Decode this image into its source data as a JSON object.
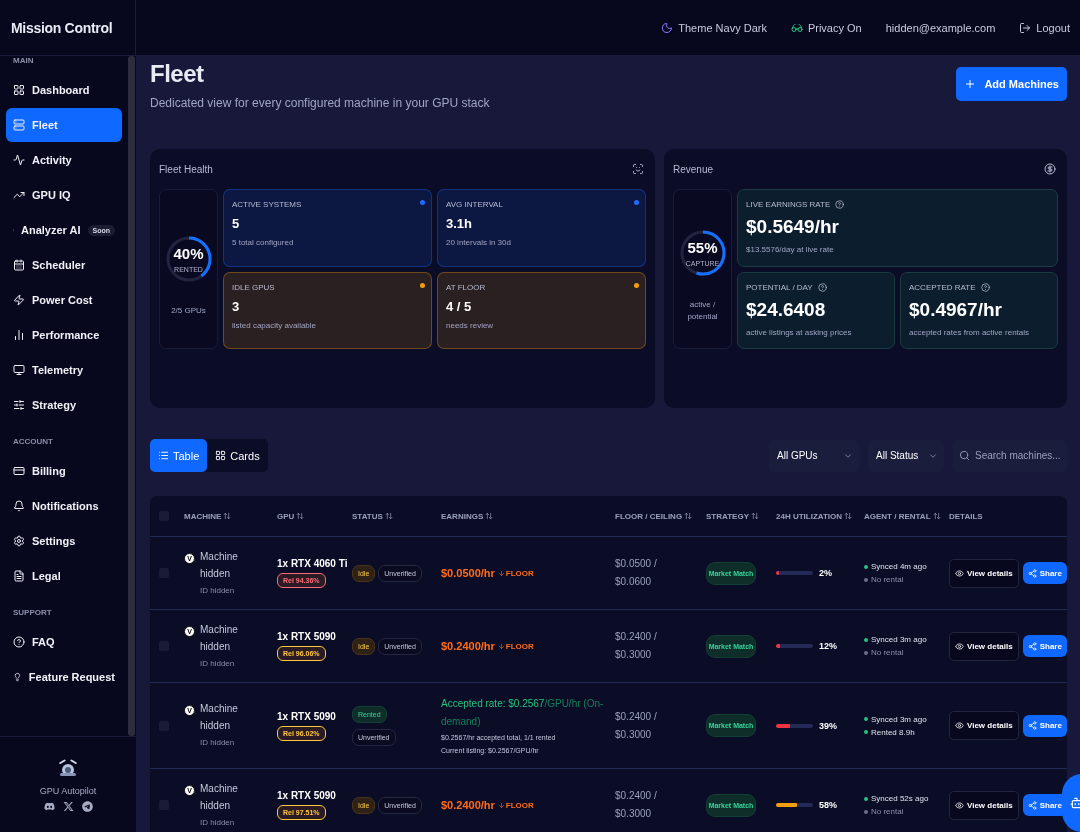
{
  "brand": "Mission Control",
  "topbar": {
    "theme": "Theme Navy Dark",
    "privacy": "Privacy On",
    "email": "hidden@example.com",
    "logout": "Logout"
  },
  "sidebar": {
    "sections": [
      {
        "title": "MAIN",
        "items": [
          {
            "label": "Dashboard",
            "selected": false
          },
          {
            "label": "Fleet",
            "selected": true
          },
          {
            "label": "Activity",
            "selected": false
          },
          {
            "label": "GPU IQ",
            "selected": false
          },
          {
            "label": "Analyzer AI",
            "selected": false,
            "badge": "Soon"
          },
          {
            "label": "Scheduler",
            "selected": false
          },
          {
            "label": "Power Cost",
            "selected": false
          },
          {
            "label": "Performance",
            "selected": false
          },
          {
            "label": "Telemetry",
            "selected": false
          },
          {
            "label": "Strategy",
            "selected": false
          }
        ]
      },
      {
        "title": "ACCOUNT",
        "items": [
          {
            "label": "Billing",
            "selected": false
          },
          {
            "label": "Notifications",
            "selected": false
          },
          {
            "label": "Settings",
            "selected": false
          },
          {
            "label": "Legal",
            "selected": false
          }
        ]
      },
      {
        "title": "SUPPORT",
        "items": [
          {
            "label": "FAQ",
            "selected": false
          },
          {
            "label": "Feature Request",
            "selected": false
          }
        ]
      }
    ],
    "footer": "GPU Autopilot"
  },
  "page": {
    "title": "Fleet",
    "subtitle": "Dedicated view for every configured machine in your GPU stack",
    "add_button": "Add Machines"
  },
  "fleet_health": {
    "title": "Fleet Health",
    "gauge": {
      "value": "40%",
      "label": "RENTED",
      "level": 0.4,
      "caption": "2/5 GPUs"
    },
    "stats": [
      {
        "label": "ACTIVE SYSTEMS",
        "value": "5",
        "note": "5 total configured",
        "color": "#1e6bff"
      },
      {
        "label": "AVG INTERVAL",
        "value": "3.1h",
        "note": "20 intervals in 30d",
        "color": "#1e6bff"
      },
      {
        "label": "IDLE GPUS",
        "value": "3",
        "note": "listed capacity available",
        "color": "#f59e0b"
      },
      {
        "label": "AT FLOOR",
        "value": "4 / 5",
        "note": "needs review",
        "color": "#f59e0b"
      }
    ]
  },
  "revenue": {
    "title": "Revenue",
    "gauge": {
      "value": "55%",
      "label": "CAPTURE",
      "level": 0.55,
      "caption": "active / potential"
    },
    "stats": [
      {
        "label": "LIVE EARNINGS RATE",
        "value": "$0.5649/hr",
        "note": "$13.5576/day at live rate"
      },
      {
        "label": "POTENTIAL / DAY",
        "value": "$24.6408",
        "note": "active listings at asking prices"
      },
      {
        "label": "ACCEPTED RATE",
        "value": "$0.4967/hr",
        "note": "accepted rates from active rentals"
      }
    ]
  },
  "view_toggle": [
    {
      "label": "Table",
      "selected": true
    },
    {
      "label": "Cards",
      "selected": false
    }
  ],
  "filters": [
    "All GPUs",
    "All Status"
  ],
  "search": {
    "placeholder": "Search machines..."
  },
  "table": {
    "select_all": {
      "checked": false
    },
    "columns": [
      {
        "label": "MACHINE",
        "sortable": true
      },
      {
        "label": "GPU",
        "sortable": true
      },
      {
        "label": "STATUS",
        "sortable": true
      },
      {
        "label": "EARNINGS",
        "sortable": true
      },
      {
        "label": "FLOOR / CEILING",
        "sortable": true
      },
      {
        "label": "STRATEGY",
        "sortable": true
      },
      {
        "label": "24H UTILIZATION",
        "sortable": true
      },
      {
        "label": "AGENT / RENTAL",
        "sortable": true
      },
      {
        "label": "DETAILS",
        "sortable": false
      }
    ],
    "rows": [
      {
        "checked": false,
        "logo": "V",
        "name": "Machine hidden",
        "id": "ID hidden",
        "gpu": "1x RTX 4060 Ti",
        "reliability": {
          "text": "Rel 94.36%",
          "color": "#ff6b78"
        },
        "statuses": [
          {
            "label": "Idle",
            "kind": "idle"
          },
          {
            "label": "Unverified",
            "kind": "unverified"
          }
        ],
        "earnings": {
          "kind": "floor",
          "rate": "$0.0500/hr",
          "tag": "FLOOR"
        },
        "floor": "$0.0500 /",
        "ceiling": "$0.0600",
        "strategy": "Market Match",
        "utilization": {
          "level": 0.02,
          "reading": "2%",
          "color": "#ef3340"
        },
        "agent": [
          {
            "text": "Synced 4m ago",
            "color": "#22c57e"
          },
          {
            "text": "No rental",
            "color": "#6b7288"
          }
        ],
        "view": "View details",
        "share": "Share"
      },
      {
        "checked": false,
        "logo": "V",
        "name": "Machine hidden",
        "id": "ID hidden",
        "gpu": "1x RTX 5090",
        "reliability": {
          "text": "Rel 96.06%",
          "color": "#ffc83d"
        },
        "statuses": [
          {
            "label": "Idle",
            "kind": "idle"
          },
          {
            "label": "Unverified",
            "kind": "unverified"
          }
        ],
        "earnings": {
          "kind": "floor",
          "rate": "$0.2400/hr",
          "tag": "FLOOR"
        },
        "floor": "$0.2400 /",
        "ceiling": "$0.3000",
        "strategy": "Market Match",
        "utilization": {
          "level": 0.12,
          "reading": "12%",
          "color": "#ef3340"
        },
        "agent": [
          {
            "text": "Synced 3m ago",
            "color": "#22c57e"
          },
          {
            "text": "No rental",
            "color": "#6b7288"
          }
        ],
        "view": "View details",
        "share": "Share"
      },
      {
        "checked": false,
        "logo": "V",
        "name": "Machine hidden",
        "id": "ID hidden",
        "gpu": "1x RTX 5090",
        "reliability": {
          "text": "Rel 96.02%",
          "color": "#ffc83d"
        },
        "statuses": [
          {
            "label": "Rented",
            "kind": "rented"
          },
          {
            "label": "Unverified",
            "kind": "unverified"
          }
        ],
        "earnings": {
          "kind": "accepted",
          "headline": "Accepted rate: $0.2567",
          "suffix": "/GPU/hr (On-demand)",
          "lines": [
            "$0.2567/hr accepted total, 1/1 rented",
            "Current listing: $0.2567/GPU/hr"
          ]
        },
        "floor": "$0.2400 /",
        "ceiling": "$0.3000",
        "strategy": "Market Match",
        "utilization": {
          "level": 0.39,
          "reading": "39%",
          "color": "#ef3340"
        },
        "agent": [
          {
            "text": "Synced 3m ago",
            "color": "#22c57e"
          },
          {
            "text": "Rented 8.9h",
            "color": "#22c57e"
          }
        ],
        "view": "View details",
        "share": "Share"
      },
      {
        "checked": false,
        "logo": "V",
        "name": "Machine hidden",
        "id": "ID hidden",
        "gpu": "1x RTX 5090",
        "reliability": {
          "text": "Rel 97.51%",
          "color": "#ffc83d"
        },
        "statuses": [
          {
            "label": "Idle",
            "kind": "idle"
          },
          {
            "label": "Unverified",
            "kind": "unverified"
          }
        ],
        "earnings": {
          "kind": "floor",
          "rate": "$0.2400/hr",
          "tag": "FLOOR"
        },
        "floor": "$0.2400 /",
        "ceiling": "$0.3000",
        "strategy": "Market Match",
        "utilization": {
          "level": 0.58,
          "reading": "58%",
          "color": "#f59e0b"
        },
        "agent": [
          {
            "text": "Synced 52s ago",
            "color": "#22c57e"
          },
          {
            "text": "No rental",
            "color": "#6b7288"
          }
        ],
        "view": "View details",
        "share": "Share"
      }
    ]
  }
}
